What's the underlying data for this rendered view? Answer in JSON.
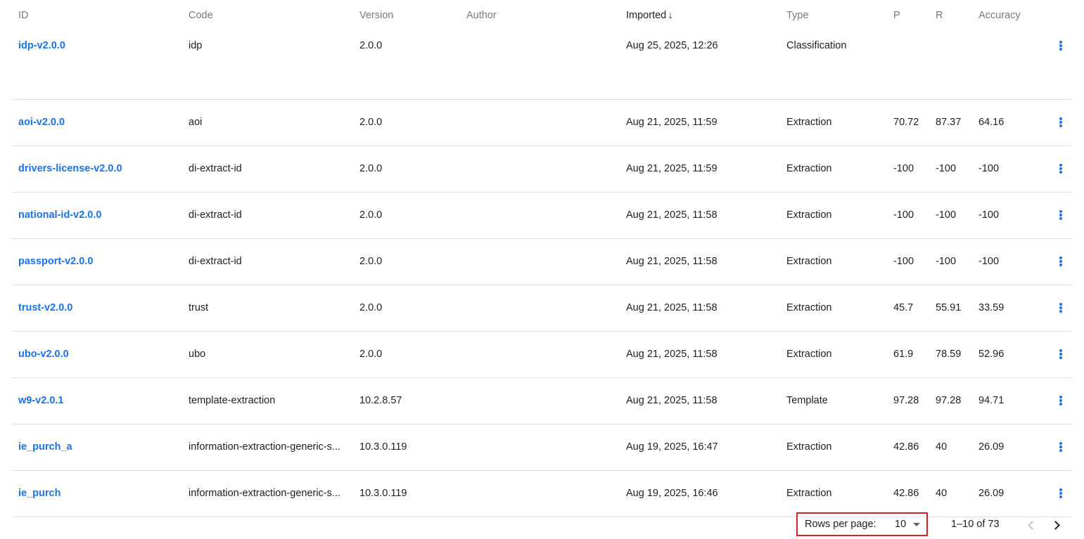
{
  "table": {
    "columns": {
      "id": "ID",
      "code": "Code",
      "version": "Version",
      "author": "Author",
      "imported": "Imported",
      "type": "Type",
      "p": "P",
      "r": "R",
      "accuracy": "Accuracy"
    },
    "sort_indicator": "↓",
    "rows": [
      {
        "id": "idp-v2.0.0",
        "code": "idp",
        "version": "2.0.0",
        "author": "",
        "imported": "Aug 25, 2025, 12:26",
        "type": "Classification",
        "p": "",
        "r": "",
        "accuracy": ""
      },
      {
        "id": "aoi-v2.0.0",
        "code": "aoi",
        "version": "2.0.0",
        "author": "",
        "imported": "Aug 21, 2025, 11:59",
        "type": "Extraction",
        "p": "70.72",
        "r": "87.37",
        "accuracy": "64.16"
      },
      {
        "id": "drivers-license-v2.0.0",
        "code": "di-extract-id",
        "version": "2.0.0",
        "author": "",
        "imported": "Aug 21, 2025, 11:59",
        "type": "Extraction",
        "p": "-100",
        "r": "-100",
        "accuracy": "-100"
      },
      {
        "id": "national-id-v2.0.0",
        "code": "di-extract-id",
        "version": "2.0.0",
        "author": "",
        "imported": "Aug 21, 2025, 11:58",
        "type": "Extraction",
        "p": "-100",
        "r": "-100",
        "accuracy": "-100"
      },
      {
        "id": "passport-v2.0.0",
        "code": "di-extract-id",
        "version": "2.0.0",
        "author": "",
        "imported": "Aug 21, 2025, 11:58",
        "type": "Extraction",
        "p": "-100",
        "r": "-100",
        "accuracy": "-100"
      },
      {
        "id": "trust-v2.0.0",
        "code": "trust",
        "version": "2.0.0",
        "author": "",
        "imported": "Aug 21, 2025, 11:58",
        "type": "Extraction",
        "p": "45.7",
        "r": "55.91",
        "accuracy": "33.59"
      },
      {
        "id": "ubo-v2.0.0",
        "code": "ubo",
        "version": "2.0.0",
        "author": "",
        "imported": "Aug 21, 2025, 11:58",
        "type": "Extraction",
        "p": "61.9",
        "r": "78.59",
        "accuracy": "52.96"
      },
      {
        "id": "w9-v2.0.1",
        "code": "template-extraction",
        "version": "10.2.8.57",
        "author": "",
        "imported": "Aug 21, 2025, 11:58",
        "type": "Template",
        "p": "97.28",
        "r": "97.28",
        "accuracy": "94.71"
      },
      {
        "id": "ie_purch_a",
        "code": "information-extraction-generic-s...",
        "version": "10.3.0.119",
        "author": "",
        "imported": "Aug 19, 2025, 16:47",
        "type": "Extraction",
        "p": "42.86",
        "r": "40",
        "accuracy": "26.09"
      },
      {
        "id": "ie_purch",
        "code": "information-extraction-generic-s...",
        "version": "10.3.0.119",
        "author": "",
        "imported": "Aug 19, 2025, 16:46",
        "type": "Extraction",
        "p": "42.86",
        "r": "40",
        "accuracy": "26.09"
      }
    ],
    "row_menu_icon": "more-vert-icon"
  },
  "pagination": {
    "rows_per_page_label": "Rows per page:",
    "rows_per_page_value": "10",
    "range_text": "1–10 of 73",
    "prev_icon": "chevron-left-icon",
    "next_icon": "chevron-right-icon"
  },
  "colors": {
    "link": "#1a73e8",
    "highlight_border": "#d6202a",
    "divider": "#e0e0e0"
  }
}
